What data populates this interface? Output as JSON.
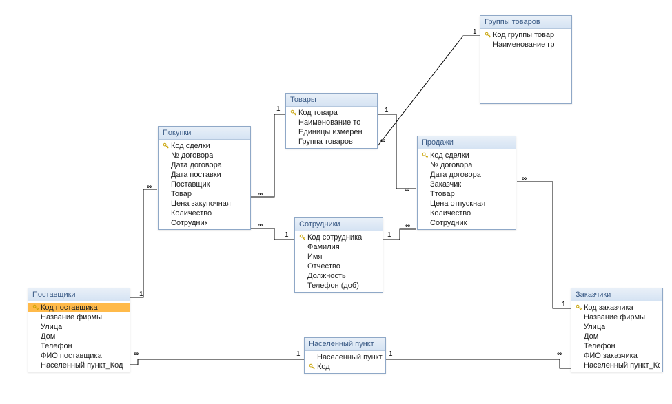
{
  "tables": {
    "postavshchiki": {
      "title": "Поставщики",
      "fields": [
        {
          "label": "Код поставщика",
          "key": true,
          "selected": true
        },
        {
          "label": "Название фирмы",
          "key": false
        },
        {
          "label": "Улица",
          "key": false
        },
        {
          "label": "Дом",
          "key": false
        },
        {
          "label": "Телефон",
          "key": false
        },
        {
          "label": "ФИО поставщика",
          "key": false
        },
        {
          "label": "Населенный пункт_Код",
          "key": false
        }
      ]
    },
    "pokupki": {
      "title": "Покупки",
      "fields": [
        {
          "label": "Код сделки",
          "key": true
        },
        {
          "label": "№ договора",
          "key": false
        },
        {
          "label": "Дата договора",
          "key": false
        },
        {
          "label": "Дата поставки",
          "key": false
        },
        {
          "label": "Поставщик",
          "key": false
        },
        {
          "label": "Товар",
          "key": false
        },
        {
          "label": "Цена закупочная",
          "key": false
        },
        {
          "label": "Количество",
          "key": false
        },
        {
          "label": "Сотрудник",
          "key": false
        }
      ]
    },
    "tovary": {
      "title": "Товары",
      "fields": [
        {
          "label": "Код товара",
          "key": true
        },
        {
          "label": "Наименование то",
          "key": false
        },
        {
          "label": "Единицы измерен",
          "key": false
        },
        {
          "label": "Группа товаров",
          "key": false
        }
      ]
    },
    "gruppy": {
      "title": "Группы товаров",
      "fields": [
        {
          "label": "Код группы товар",
          "key": true
        },
        {
          "label": "Наименование гр",
          "key": false
        }
      ]
    },
    "prodazhi": {
      "title": "Продажи",
      "fields": [
        {
          "label": "Код сделки",
          "key": true
        },
        {
          "label": "№ договора",
          "key": false
        },
        {
          "label": "Дата договора",
          "key": false
        },
        {
          "label": "Заказчик",
          "key": false
        },
        {
          "label": "Ттовар",
          "key": false
        },
        {
          "label": "Цена отпускная",
          "key": false
        },
        {
          "label": "Количество",
          "key": false
        },
        {
          "label": "Сотрудник",
          "key": false
        }
      ]
    },
    "sotrudniki": {
      "title": "Сотрудники",
      "fields": [
        {
          "label": "Код сотрудника",
          "key": true
        },
        {
          "label": "Фамилия",
          "key": false
        },
        {
          "label": "Имя",
          "key": false
        },
        {
          "label": "Отчество",
          "key": false
        },
        {
          "label": "Должность",
          "key": false
        },
        {
          "label": "Телефон (доб)",
          "key": false
        }
      ]
    },
    "punkt": {
      "title": "Населенный пункт",
      "fields": [
        {
          "label": "Населенный пункт",
          "key": false
        },
        {
          "label": "Код",
          "key": true
        }
      ]
    },
    "zakazchiki": {
      "title": "Заказчики",
      "fields": [
        {
          "label": "Код заказчика",
          "key": true
        },
        {
          "label": "Название фирмы",
          "key": false
        },
        {
          "label": "Улица",
          "key": false
        },
        {
          "label": "Дом",
          "key": false
        },
        {
          "label": "Телефон",
          "key": false
        },
        {
          "label": "ФИО заказчика",
          "key": false
        },
        {
          "label": "Населенный пункт_Код",
          "key": false
        }
      ]
    }
  },
  "cardinality": {
    "one": "1",
    "many": "∞"
  },
  "chart_data": {
    "type": "er-diagram",
    "entities": [
      "Поставщики",
      "Покупки",
      "Товары",
      "Группы товаров",
      "Продажи",
      "Сотрудники",
      "Населенный пункт",
      "Заказчики"
    ],
    "relationships": [
      {
        "from": "Поставщики",
        "to": "Покупки",
        "from_card": "1",
        "to_card": "∞"
      },
      {
        "from": "Товары",
        "to": "Покупки",
        "from_card": "1",
        "to_card": "∞"
      },
      {
        "from": "Товары",
        "to": "Продажи",
        "from_card": "1",
        "to_card": "∞"
      },
      {
        "from": "Группы товаров",
        "to": "Товары",
        "from_card": "1",
        "to_card": "∞"
      },
      {
        "from": "Сотрудники",
        "to": "Покупки",
        "from_card": "1",
        "to_card": "∞"
      },
      {
        "from": "Сотрудники",
        "to": "Продажи",
        "from_card": "1",
        "to_card": "∞"
      },
      {
        "from": "Заказчики",
        "to": "Продажи",
        "from_card": "1",
        "to_card": "∞"
      },
      {
        "from": "Населенный пункт",
        "to": "Поставщики",
        "from_card": "1",
        "to_card": "∞"
      },
      {
        "from": "Населенный пункт",
        "to": "Заказчики",
        "from_card": "1",
        "to_card": "∞"
      }
    ]
  }
}
